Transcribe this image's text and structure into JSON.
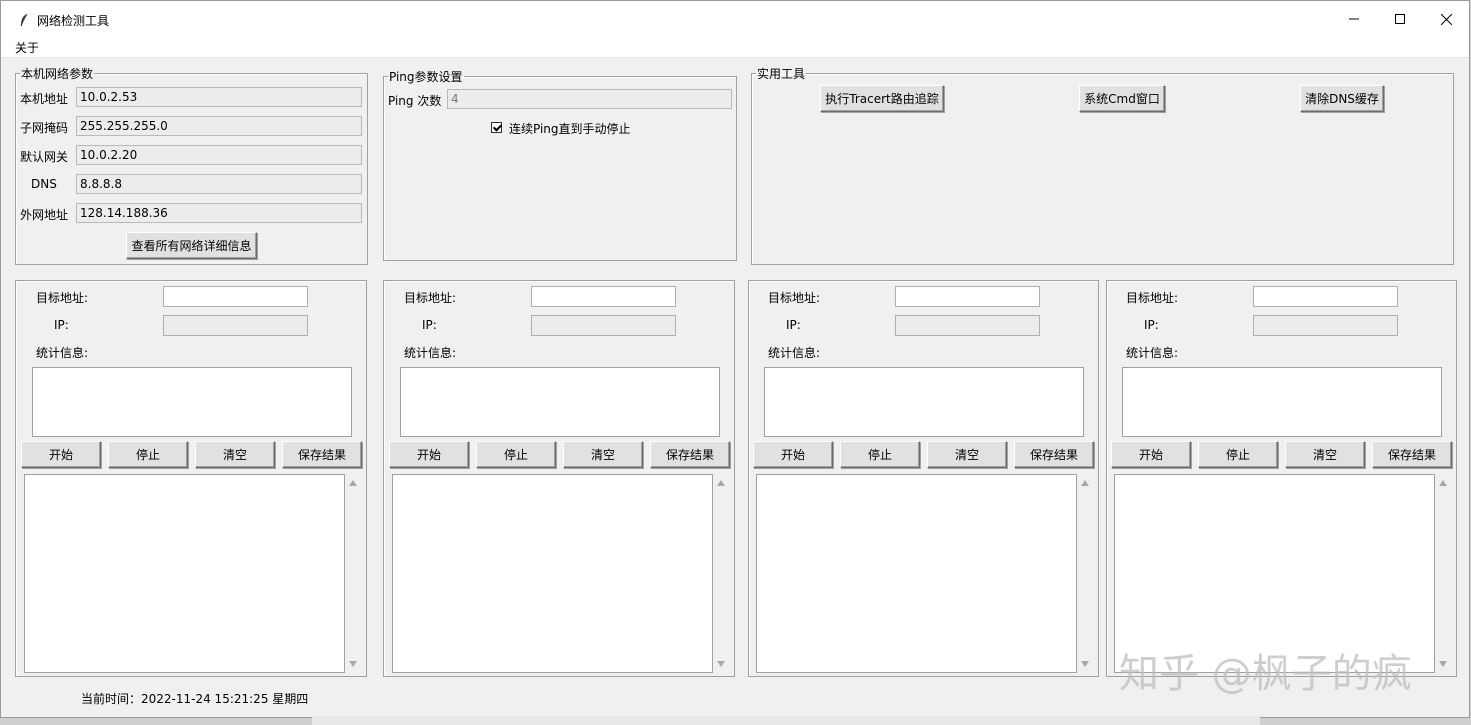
{
  "window": {
    "title": "网络检测工具"
  },
  "menu": {
    "about": "关于"
  },
  "local": {
    "legend": "本机网络参数",
    "rows": [
      {
        "label": "本机地址",
        "value": "10.0.2.53"
      },
      {
        "label": "子网掩码",
        "value": "255.255.255.0"
      },
      {
        "label": "默认网关",
        "value": "10.0.2.20"
      },
      {
        "label": "DNS",
        "value": "8.8.8.8"
      },
      {
        "label": "外网地址",
        "value": "128.14.188.36"
      }
    ],
    "details_button": "查看所有网络详细信息"
  },
  "ping": {
    "legend": "Ping参数设置",
    "count_label": "Ping 次数",
    "count_value": "4",
    "continuous_label": "连续Ping直到手动停止",
    "continuous_checked": true
  },
  "tools": {
    "legend": "实用工具",
    "buttons": [
      "执行Tracert路由追踪",
      "系统Cmd窗口",
      "清除DNS缓存"
    ]
  },
  "panel_labels": {
    "target": "目标地址:",
    "ip": "IP:",
    "stats": "统计信息:"
  },
  "panel_buttons": {
    "start": "开始",
    "stop": "停止",
    "clear": "清空",
    "save": "保存结果"
  },
  "status": {
    "time": "当前时间：2022-11-24 15:21:25  星期四"
  },
  "watermark": "知乎 @枫子的疯"
}
